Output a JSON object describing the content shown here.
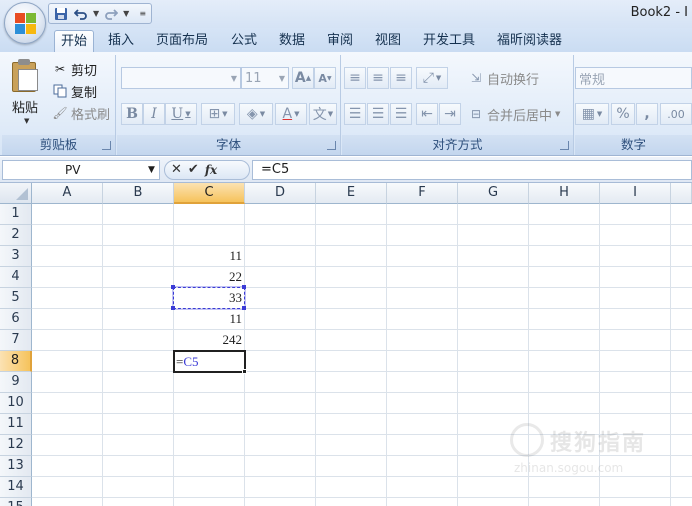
{
  "app": {
    "title": "Book2 - I"
  },
  "quick_access": {
    "save_icon": "save-icon",
    "undo_icon": "undo-icon",
    "redo_icon": "redo-icon",
    "customize_icon": "customize-qat-icon"
  },
  "tabs": [
    {
      "label": "开始",
      "active": true
    },
    {
      "label": "插入"
    },
    {
      "label": "页面布局"
    },
    {
      "label": "公式"
    },
    {
      "label": "数据"
    },
    {
      "label": "审阅"
    },
    {
      "label": "视图"
    },
    {
      "label": "开发工具"
    },
    {
      "label": "福昕阅读器"
    }
  ],
  "ribbon": {
    "clipboard": {
      "label": "剪贴板",
      "paste": "粘贴",
      "cut": "剪切",
      "copy": "复制",
      "format_painter": "格式刷"
    },
    "font": {
      "label": "字体",
      "font_name": "",
      "font_size": "11",
      "bold": "B",
      "italic": "I",
      "underline": "U",
      "grow": "A",
      "shrink": "A"
    },
    "alignment": {
      "label": "对齐方式",
      "wrap_text": "自动换行",
      "merge_center": "合并后居中"
    },
    "number": {
      "label": "数字",
      "format": "常规",
      "percent": "%",
      "comma": ",",
      "decimal": ".00"
    }
  },
  "formula_bar": {
    "name_box": "PV",
    "formula": "=C5",
    "cancel": "✕",
    "enter": "✔",
    "fx": "fx"
  },
  "grid": {
    "columns": [
      "A",
      "B",
      "C",
      "D",
      "E",
      "F",
      "G",
      "H",
      "I"
    ],
    "rows": [
      "1",
      "2",
      "3",
      "4",
      "5",
      "6",
      "7",
      "8",
      "9",
      "10",
      "11",
      "12",
      "13",
      "14",
      "15"
    ],
    "cells": {
      "C3": "11",
      "C4": "22",
      "C5": "33",
      "C6": "11",
      "C7": "242"
    },
    "editing_cell": {
      "prefix": "=",
      "ref": "C5"
    }
  },
  "watermark": {
    "text": "搜狗指南",
    "url": "zhinan.sogou.com"
  },
  "colors": {
    "selected_header": "#f6c35c",
    "reference_border": "#3b3bd6",
    "ribbon_bg": "#dfe9f6"
  }
}
